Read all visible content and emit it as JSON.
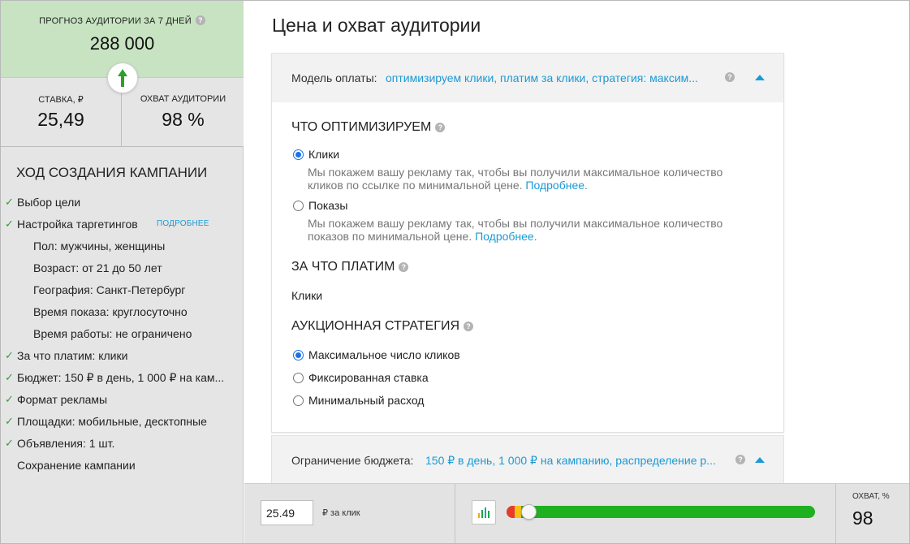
{
  "forecast": {
    "label": "ПРОГНОЗ АУДИТОРИИ ЗА 7 ДНЕЙ",
    "value": "288 000",
    "help": "?"
  },
  "stats": {
    "bid_label": "СТАВКА, ₽",
    "bid_value": "25,49",
    "reach_label": "ОХВАТ АУДИТОРИИ",
    "reach_value": "98 %"
  },
  "progress": {
    "title": "ХОД СОЗДАНИЯ КАМПАНИИ",
    "steps": [
      {
        "text": "Выбор цели",
        "done": true
      },
      {
        "text": "Настройка таргетингов",
        "done": true,
        "link": "ПОДРОБНЕЕ"
      },
      {
        "text": "Пол: мужчины, женщины",
        "sub": true
      },
      {
        "text": "Возраст: от 21 до 50 лет",
        "sub": true
      },
      {
        "text": "География: Санкт-Петербург",
        "sub": true
      },
      {
        "text": "Время показа: круглосуточно",
        "sub": true
      },
      {
        "text": "Время работы: не ограничено",
        "sub": true
      },
      {
        "text": "За что платим: клики",
        "done": true
      },
      {
        "text": "Бюджет: 150 ₽ в день, 1 000 ₽ на кам...",
        "done": true
      },
      {
        "text": "Формат рекламы",
        "done": true
      },
      {
        "text": "Площадки: мобильные, десктопные",
        "done": true
      },
      {
        "text": "Объявления: 1 шт.",
        "done": true
      },
      {
        "text": "Сохранение кампании",
        "done": false
      }
    ]
  },
  "main": {
    "title": "Цена и охват аудитории",
    "payment_panel": {
      "label": "Модель оплаты:",
      "value": "оптимизируем клики, платим за клики, стратегия: максим...",
      "optimize_title": "ЧТО ОПТИМИЗИРУЕМ",
      "opt_clicks": "Клики",
      "opt_clicks_desc_1": "Мы покажем вашу рекламу так, чтобы вы получили максимальное количество",
      "opt_clicks_desc_2": "кликов по ссылке по минимальной цене.",
      "opt_shows": "Показы",
      "opt_shows_desc_1": "Мы покажем вашу рекламу так, чтобы вы получили максимальное количество",
      "opt_shows_desc_2": "показов по минимальной цене.",
      "more_link": "Подробнее",
      "pay_title": "ЗА ЧТО ПЛАТИМ",
      "pay_value": "Клики",
      "strategy_title": "АУКЦИОННАЯ СТРАТЕГИЯ",
      "strategy_options": [
        "Максимальное число кликов",
        "Фиксированная ставка",
        "Минимальный расход"
      ]
    },
    "budget_panel": {
      "label": "Ограничение бюджета:",
      "value": "150 ₽ в день, 1 000 ₽ на кампанию, распределение р..."
    }
  },
  "bottom_bar": {
    "bid_input": "25.49",
    "bid_unit": "₽ за клик",
    "slider_level": 0.07,
    "reach_label": "ОХВАТ, %",
    "reach_value": "98"
  },
  "colors": {
    "accent": "#1a9ad6",
    "forecast_bg": "#c7e3c1",
    "arrow": "#2e9e2e",
    "slider_green": "#1fb01f"
  },
  "icons": {
    "arrow": "arrow-up-icon",
    "help": "question-icon",
    "check": "check-icon",
    "collapse": "chevron-up-icon",
    "chart": "bar-chart-icon"
  }
}
